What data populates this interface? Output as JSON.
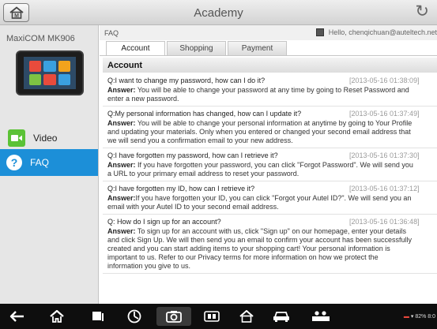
{
  "header": {
    "title": "Academy"
  },
  "sidebar": {
    "device_name": "MaxiCOM MK906",
    "items": [
      {
        "label": "Video",
        "icon": "video-icon"
      },
      {
        "label": "FAQ",
        "icon": "help-icon"
      }
    ]
  },
  "main": {
    "breadcrumb": "FAQ",
    "user_greeting": "Hello, chenqichuan@auteltech.net",
    "tabs": [
      "Account",
      "Shopping",
      "Payment"
    ],
    "section_title": "Account",
    "faqs": [
      {
        "question": "Q:I want to change my password, how can I do it?",
        "date": "[2013-05-16 01:38:09]",
        "answer_label": "Answer:",
        "answer_lines": [
          " You will be able to change your password at any time by going to Reset Password and",
          "enter a new password."
        ]
      },
      {
        "question": "Q:My personal information has changed, how can I update it?",
        "date": "[2013-05-16 01:37:49]",
        "answer_label": "Answer:",
        "answer_lines": [
          " You will be able to change your personal information at anytime by going to Your Profile",
          "and updating your materials. Only when you entered or changed your second email address that",
          "we will send you a confirmation email to your new address."
        ]
      },
      {
        "question": "Q:I have forgotten my password, how can I retrieve it?",
        "date": "[2013-05-16 01:37:30]",
        "answer_label": "Answer:",
        "answer_lines": [
          " If you have forgotten your password, you can click \"Forgot Password\". We will send you",
          "a URL to your primary email address to reset your password."
        ]
      },
      {
        "question": "Q:I have forgotten my ID, how can I retrieve it?",
        "date": "[2013-05-16 01:37:12]",
        "answer_label": "Answer:",
        "answer_lines": [
          "If you have forgotten your ID, you can click \"Forgot your Autel ID?\". We will send you an",
          "email with your Autel ID to your second email address."
        ]
      },
      {
        "question": "Q: How do I sign up for an account?",
        "date": "[2013-05-16 01:36:48]",
        "answer_label": "Answer:",
        "answer_lines": [
          " To sign up for an account with us, click \"Sign up\" on our homepage, enter your details",
          "and click Sign Up. We will then send you an email to confirm your account has been successfully",
          "created and you can start adding items to your shopping cart! Your personal information is",
          "important to us. Refer to our Privacy terms for more information on how we protect the",
          "information you give to us."
        ]
      }
    ]
  },
  "status_bar": {
    "text": "82% 8:0"
  },
  "colors": {
    "accent": "#1c8fd8",
    "video_green": "#5bc236",
    "navbar": "#0e0e0e"
  }
}
